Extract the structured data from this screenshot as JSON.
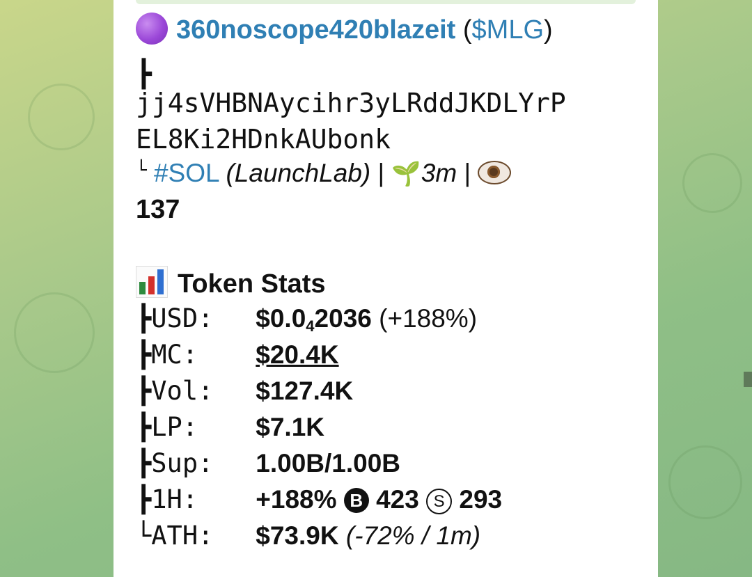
{
  "message": {
    "token_name": "360noscope420blazeit",
    "ticker": "$MLG",
    "branch_top": "┣",
    "address_line1": "jj4sVHBNAycihr3yLRddJKDLYrP",
    "address_line2": "EL8Ki2HDnkAUbonk",
    "branch_end": "└",
    "hashtag": "#SOL",
    "launchpad": "(LaunchLab)",
    "separator": "|",
    "age": "3m",
    "views": "137",
    "stats_title": "Token Stats",
    "stats": [
      {
        "branch": "┣",
        "key": "USD:",
        "value_main": "$0.0",
        "value_sub": "4",
        "value_rest": "2036",
        "value_extra": "(+188%)"
      },
      {
        "branch": "┣",
        "key": "MC:",
        "value": "$20.4K"
      },
      {
        "branch": "┣",
        "key": "Vol:",
        "value": "$127.4K"
      },
      {
        "branch": "┣",
        "key": "LP:",
        "value": "$7.1K"
      },
      {
        "branch": "┣",
        "key": "Sup:",
        "value": "1.00B/1.00B"
      },
      {
        "branch": "┣",
        "key": "1H:",
        "value_change": "+188%",
        "buy_icon": "B",
        "buys": "423",
        "sell_icon": "S",
        "sells": "293"
      },
      {
        "branch": "└",
        "key": "ATH:",
        "value": "$73.9K",
        "value_extra": "(-72% / 1m)"
      }
    ]
  },
  "colors": {
    "link": "#2f7fb4",
    "bubble": "#ffffff",
    "background": "#9cc487"
  },
  "icons": {
    "token_dot": "purple-circle-icon",
    "sprout": "seedling-icon",
    "eye": "eye-icon",
    "stats": "bar-chart-icon"
  }
}
